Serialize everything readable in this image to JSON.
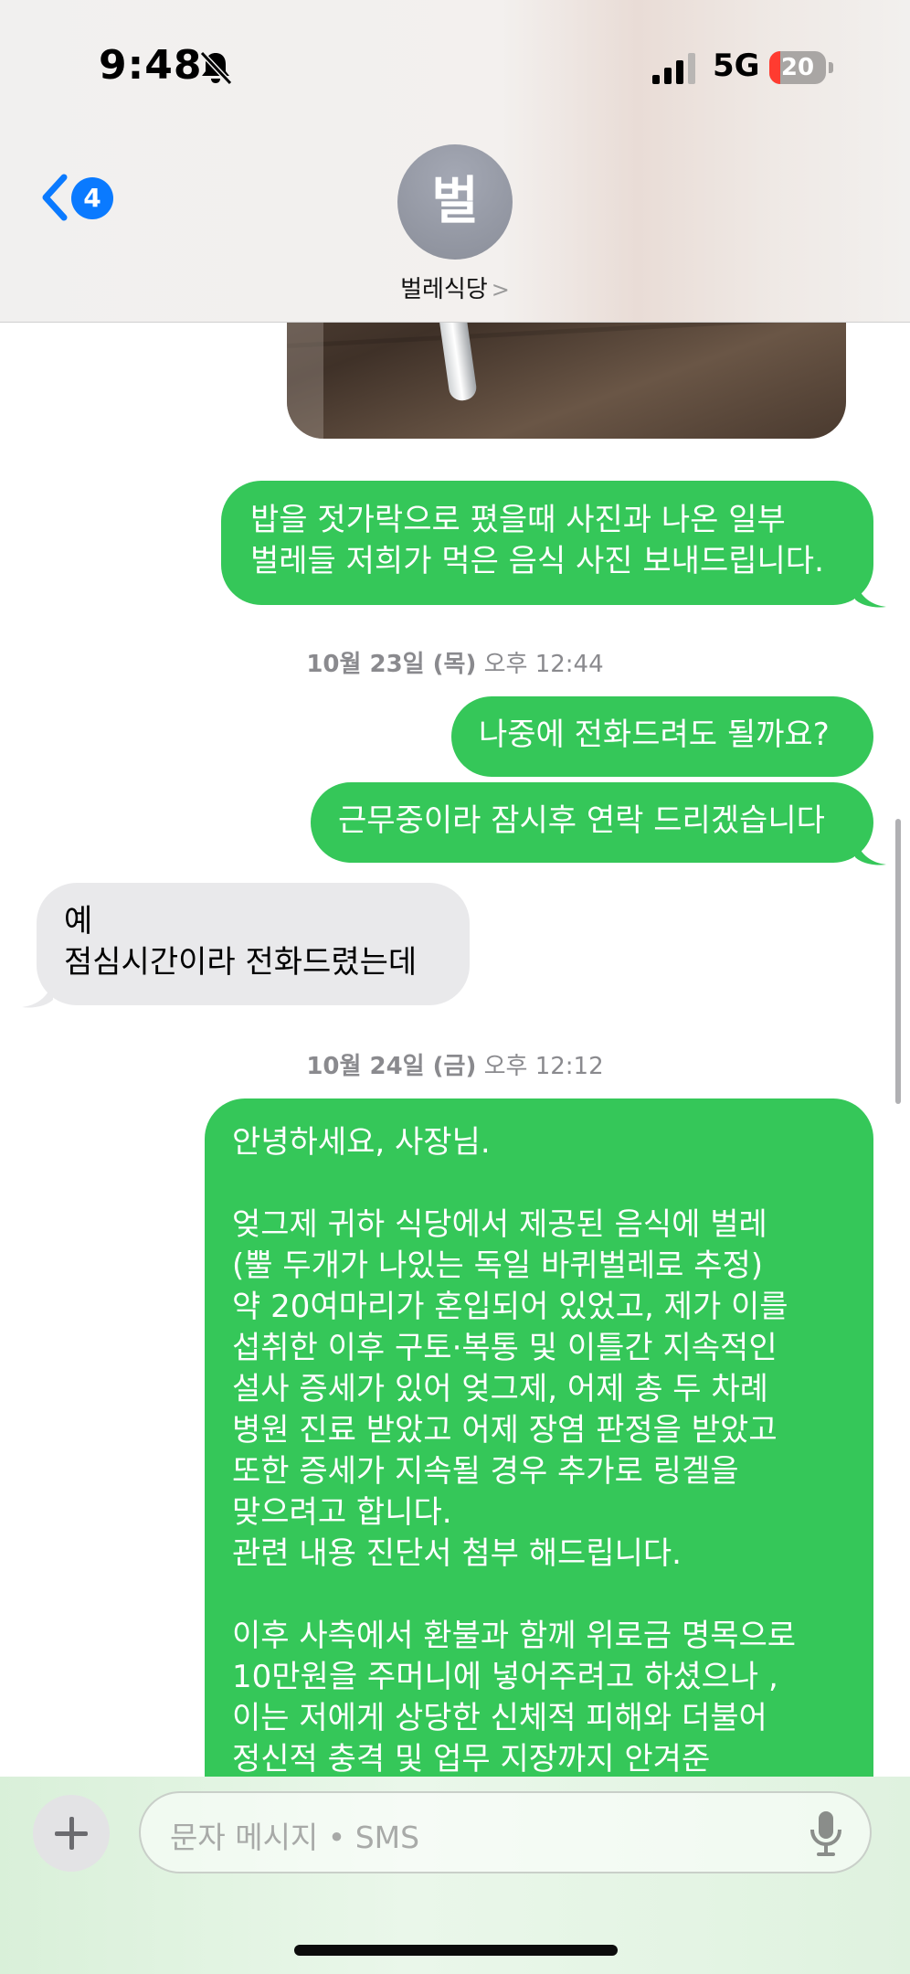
{
  "status_bar": {
    "time": "9:48",
    "network": "5G",
    "battery": "20",
    "battery_level": 0.2
  },
  "header": {
    "back_badge": "4",
    "avatar_initial": "벌",
    "contact_name": "벌레식당",
    "contact_chevron": ">"
  },
  "messages": {
    "m1": "밥을 젓가락으로 폈을때 사진과 나온 일부\n벌레들 저희가 먹은 음식 사진 보내드립니다.",
    "ts1_date": "10월 23일 (목)",
    "ts1_time": "오후 12:44",
    "m2": "나중에 전화드려도 될까요?",
    "m3": "근무중이라 잠시후 연락 드리겠습니다",
    "m4": "예\n점심시간이라 전화드렸는데",
    "ts2_date": "10월 24일 (금)",
    "ts2_time": "오후 12:12",
    "m5": "안녕하세요, 사장님.\n\n엊그제 귀하 식당에서 제공된 음식에 벌레\n(뿔 두개가 나있는 독일 바퀴벌레로 추정)\n약 20여마리가 혼입되어 있었고, 제가 이를\n섭취한 이후 구토·복통 및 이틀간 지속적인\n설사 증세가 있어 엊그제, 어제 총 두 차례\n병원 진료 받았고 어제 장염 판정을 받았고\n또한 증세가 지속될 경우 추가로 링겔을\n맞으려고 합니다.\n관련 내용 진단서 첨부 해드립니다.\n\n이후 사측에서 환불과 함께 위로금 명목으로\n10만원을 주머니에 넣어주려고 하셨으나 ,\n이는 저에게 상당한 신체적 피해와 더불어\n정신적 충격 및 업무 지장까지 안겨준"
  },
  "input": {
    "placeholder": "문자 메시지 • SMS"
  },
  "colors": {
    "sent_bubble": "#35c759",
    "received_bubble": "#e9e9eb",
    "badge": "#0a7aff",
    "battery_low": "#ff3b30"
  },
  "icons": [
    "bell-slash-icon",
    "signal-icon",
    "battery-icon",
    "chevron-left-icon",
    "plus-icon",
    "mic-icon"
  ]
}
